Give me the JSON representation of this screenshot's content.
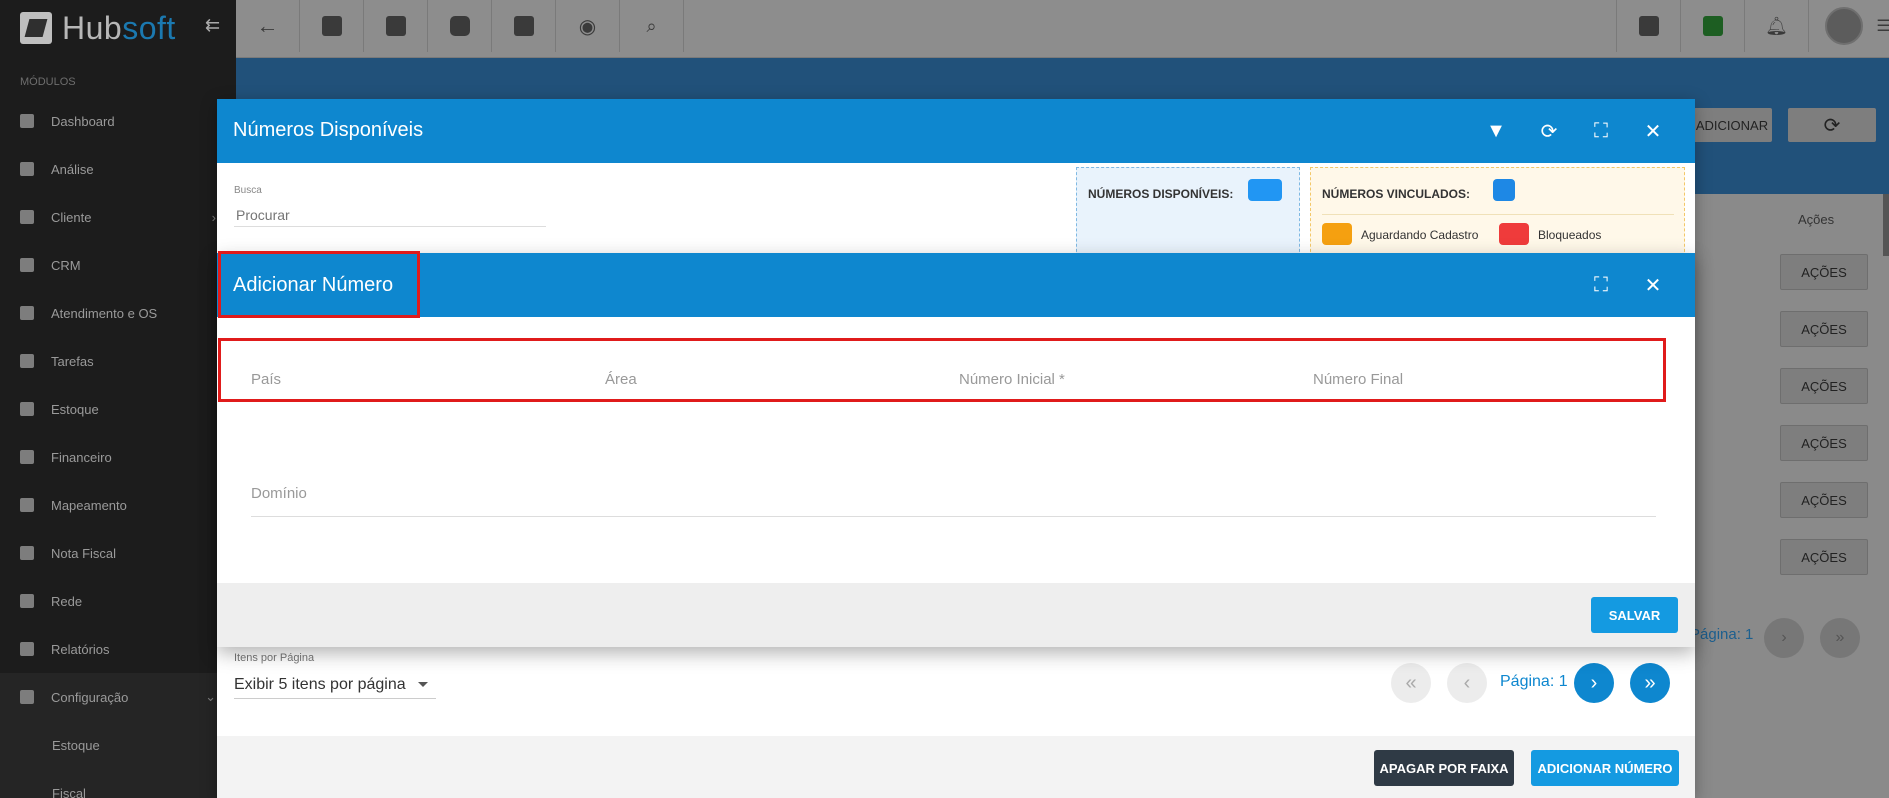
{
  "sidebar": {
    "logo_prefix": "Hub",
    "logo_suffix": "soft",
    "collapse_icon": "⇇",
    "section_label": "MÓDULOS",
    "items": [
      {
        "label": "Dashboard"
      },
      {
        "label": "Análise"
      },
      {
        "label": "Cliente"
      },
      {
        "label": "CRM"
      },
      {
        "label": "Atendimento e OS"
      },
      {
        "label": "Tarefas"
      },
      {
        "label": "Estoque"
      },
      {
        "label": "Financeiro"
      },
      {
        "label": "Mapeamento"
      },
      {
        "label": "Nota Fiscal"
      },
      {
        "label": "Rede"
      },
      {
        "label": "Relatórios"
      },
      {
        "label": "Configuração"
      }
    ],
    "subitems": [
      {
        "label": "Estoque"
      },
      {
        "label": "Fiscal"
      }
    ]
  },
  "topbar": {
    "icons": [
      "back-arrow-icon",
      "contact-card-icon",
      "calendar-clock-icon",
      "dollar-icon",
      "terminal-icon",
      "eye-icon",
      "search-icon"
    ],
    "right_icons": [
      "pdf-icon",
      "chat-check-icon",
      "bell-icon",
      "avatar",
      "menu-icon"
    ]
  },
  "background": {
    "adicionar_label": "ADICIONAR",
    "acoes_header": "Ações",
    "acoes_label": "AÇÕES",
    "pagina": "Página: 1"
  },
  "outer_modal": {
    "title": "Números Disponíveis",
    "busca_label": "Busca",
    "busca_placeholder": "Procurar",
    "legend_disponiveis": "NÚMEROS DISPONÍVEIS:",
    "legend_vinculados": "NÚMEROS VINCULADOS:",
    "legend_aguardando": "Aguardando Cadastro",
    "legend_bloqueados": "Bloqueados",
    "itens_label": "Itens por Página",
    "itens_value": "Exibir 5 itens por página",
    "pagina": "Página: 1",
    "btn_apagar": "APAGAR POR FAIXA",
    "btn_adicionar": "ADICIONAR NÚMERO"
  },
  "inner_modal": {
    "title": "Adicionar Número",
    "fields": {
      "pais": "País",
      "area": "Área",
      "numero_inicial": "Número Inicial *",
      "numero_final": "Número Final",
      "dominio": "Domínio"
    },
    "btn_salvar": "SALVAR"
  },
  "colors": {
    "header_blue": "#0e87cf",
    "button_blue": "#149ae1",
    "highlight_red": "#e01b1b",
    "disponivel": "#2196f3",
    "vinculado": "#1e88e5",
    "aguardando": "#f5a010",
    "bloqueado": "#ef3b3b"
  }
}
